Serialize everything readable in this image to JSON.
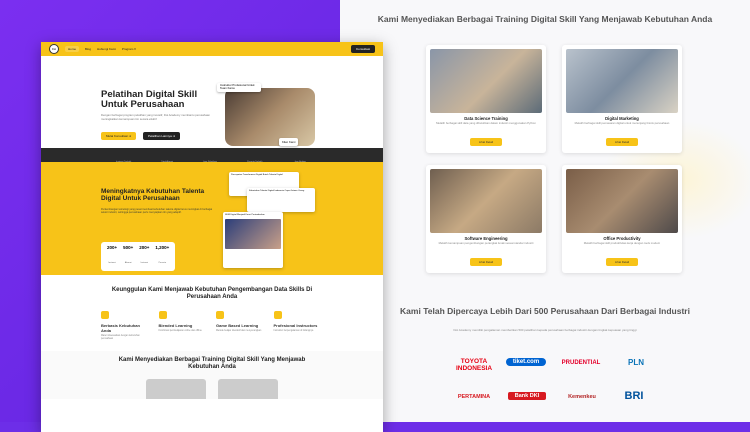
{
  "nav": {
    "logo": "Dot",
    "items": [
      "Home",
      "Blog",
      "Hubungi Kami",
      "Program ▾"
    ],
    "cta": "Konsultasi"
  },
  "hero": {
    "title": "Pelatihan Digital Skill Untuk Perusahaan",
    "desc": "Dengan berbagai program pelatihan yang inovatif, Dot Academy membantu perusahaan meningkatkan kemampuan tim secara efektif",
    "btn_primary": "Mulai Konsultasi ➔",
    "btn_secondary": "Pelatihan Lainnya ➔",
    "tag": "Instruktur Profesional Untuk Team Kamu",
    "client": "Klien Kami"
  },
  "stats": [
    {
      "value": "200+",
      "label": "Instansi Terlatih"
    },
    {
      "value": "250+",
      "label": "Total Alumni"
    },
    {
      "value": "500+",
      "label": "Jam Pelatihan"
    },
    {
      "value": "1,200+",
      "label": "Peserta Terlatih"
    },
    {
      "value": "9,000+",
      "label": "Jam Belajar"
    }
  ],
  "yellow": {
    "title": "Meningkatnya Kebutuhan Talenta Digital Untuk Perusahaan",
    "desc": "Perkembangan teknologi yang pesat membuat kebutuhan talenta digital terus meningkat di berbagai sektor industri, sehingga perusahaan perlu menyiapkan tim yang adaptif.",
    "stats": [
      {
        "value": "200+",
        "label": "Instansi"
      },
      {
        "value": "500+",
        "label": "Alumni"
      },
      {
        "value": "200+",
        "label": "Instansi"
      },
      {
        "value": "1,200+",
        "label": "Peserta"
      }
    ],
    "cards": [
      "Percepatan Transformasi Digital Butuh Talenta Digital",
      "Kebutuhan Talenta Digital Indonesia Capai Jutaan Orang",
      "SDM Digital Menjadi Kunci Pertumbuhan"
    ]
  },
  "features": {
    "title": "Keunggulan Kami Menjawab Kebutuhan Pengembangan Data Skills Di Perusahaan Anda",
    "items": [
      {
        "name": "Berbasis Kebutuhan Anda",
        "desc": "Materi disesuaikan dengan kebutuhan perusahaan"
      },
      {
        "name": "Blended Learning",
        "desc": "Kombinasi pembelajaran online dan offline"
      },
      {
        "name": "Game Based Learning",
        "desc": "Metode belajar interaktif dan menyenangkan"
      },
      {
        "name": "Profesional Instructors",
        "desc": "Instruktur berpengalaman di bidangnya"
      }
    ]
  },
  "training_mini_title": "Kami Menyediakan Berbagai Training Digital Skill Yang Menjawab Kebutuhan Anda",
  "training": {
    "title": "Kami Menyediakan Berbagai Training Digital Skill Yang Menjawab Kebutuhan Anda",
    "button": "Lihat Detail",
    "cards": [
      {
        "name": "Data Science Training",
        "desc": "Melatih berbagai skill data yang dibutuhkan dalam industri menggunakan Python"
      },
      {
        "name": "Digital Marketing",
        "desc": "Melatih berbagai skill pemasaran digital untuk menunjang bisnis perusahaan"
      },
      {
        "name": "Software Engineering",
        "desc": "Melatih kemampuan pengembangan perangkat lunak sesuai standar industri"
      },
      {
        "name": "Office Productivity",
        "desc": "Melatih berbagai skill produktivitas kerja dengan tools modern"
      }
    ]
  },
  "partners": {
    "title": "Kami Telah Dipercaya Lebih Dari 500 Perusahaan Dari Berbagai Industri",
    "desc": "Dot Academy memiliki pengalaman memberikan 500 pelatihan kepada perusahaan berbagai industri dengan tingkat kepuasan yang tinggi",
    "logos": [
      {
        "name": "TOYOTA INDONESIA",
        "color": "#e60012"
      },
      {
        "name": "tiket.com",
        "color": "#0064d2"
      },
      {
        "name": "PRUDENTIAL",
        "color": "#e4002b"
      },
      {
        "name": "PLN",
        "color": "#0b74b8"
      },
      {
        "name": "PERTAMINA",
        "color": "#d71920"
      },
      {
        "name": "Bank DKI",
        "color": "#d71920"
      },
      {
        "name": "Kemenkeu",
        "color": "#b22222"
      },
      {
        "name": "BRI",
        "color": "#00529c"
      }
    ]
  }
}
